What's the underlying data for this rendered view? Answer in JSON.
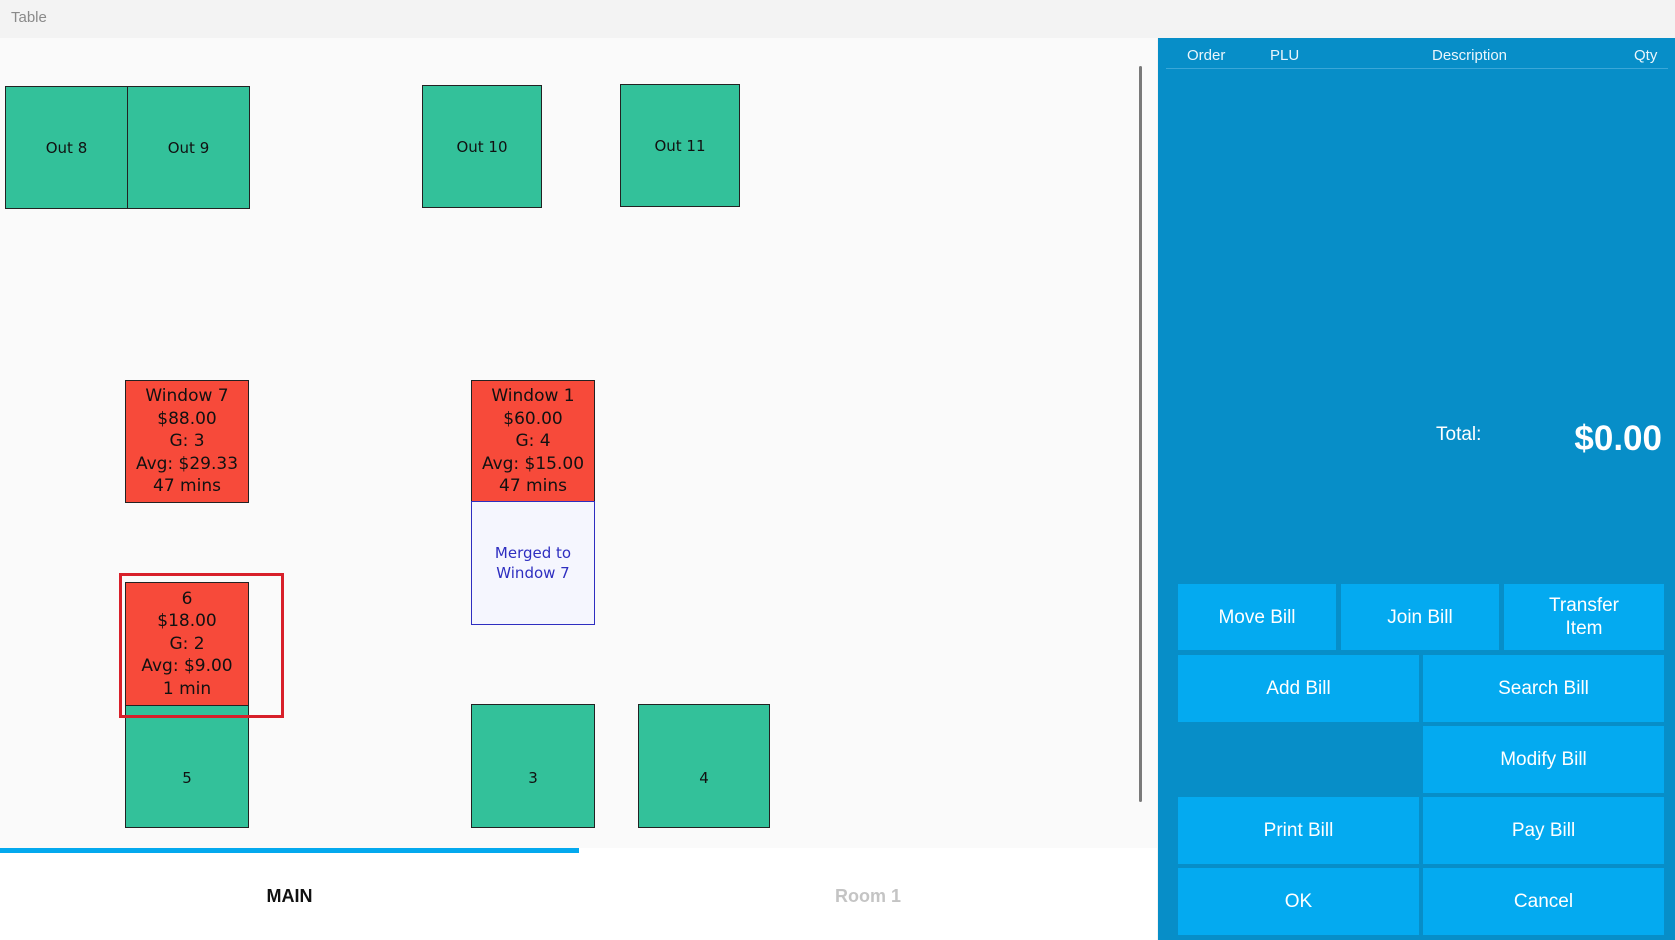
{
  "window": {
    "title": "Table"
  },
  "floor": {
    "tables": [
      {
        "label": "Out 8"
      },
      {
        "label": "Out 9"
      },
      {
        "label": "Out 10"
      },
      {
        "label": "Out 11"
      },
      {
        "name": "Window 7",
        "amount": "$88.00",
        "guests": "G: 3",
        "avg": "Avg: $29.33",
        "time": "47 mins"
      },
      {
        "name": "Window 1",
        "amount": "$60.00",
        "guests": "G: 4",
        "avg": "Avg: $15.00",
        "time": "47 mins"
      },
      {
        "line1": "Merged to",
        "line2": "Window 7"
      },
      {
        "name": "6",
        "amount": "$18.00",
        "guests": "G: 2",
        "avg": "Avg: $9.00",
        "time": "1 min"
      },
      {
        "label": "5"
      },
      {
        "label": "3"
      },
      {
        "label": "4"
      }
    ]
  },
  "tabs": [
    {
      "label": "MAIN",
      "active": true
    },
    {
      "label": "Room 1",
      "active": false
    }
  ],
  "order_panel": {
    "columns": [
      "Order",
      "PLU",
      "Description",
      "Qty"
    ],
    "total_label": "Total:",
    "total_value": "$0.00"
  },
  "actions": {
    "move_bill": "Move Bill",
    "join_bill": "Join Bill",
    "transfer_item_1": "Transfer",
    "transfer_item_2": "Item",
    "add_bill": "Add Bill",
    "search_bill": "Search Bill",
    "modify_bill": "Modify Bill",
    "print_bill": "Print Bill",
    "pay_bill": "Pay Bill",
    "ok": "OK",
    "cancel": "Cancel"
  },
  "colors": {
    "free_table": "#33c19a",
    "occupied_table": "#f74a3a",
    "merged_table_text": "#2e2ec0",
    "panel": "#078ec8",
    "button": "#04aaf0",
    "selection_outline": "#d8202a",
    "active_tab_indicator": "#04a9ee"
  }
}
